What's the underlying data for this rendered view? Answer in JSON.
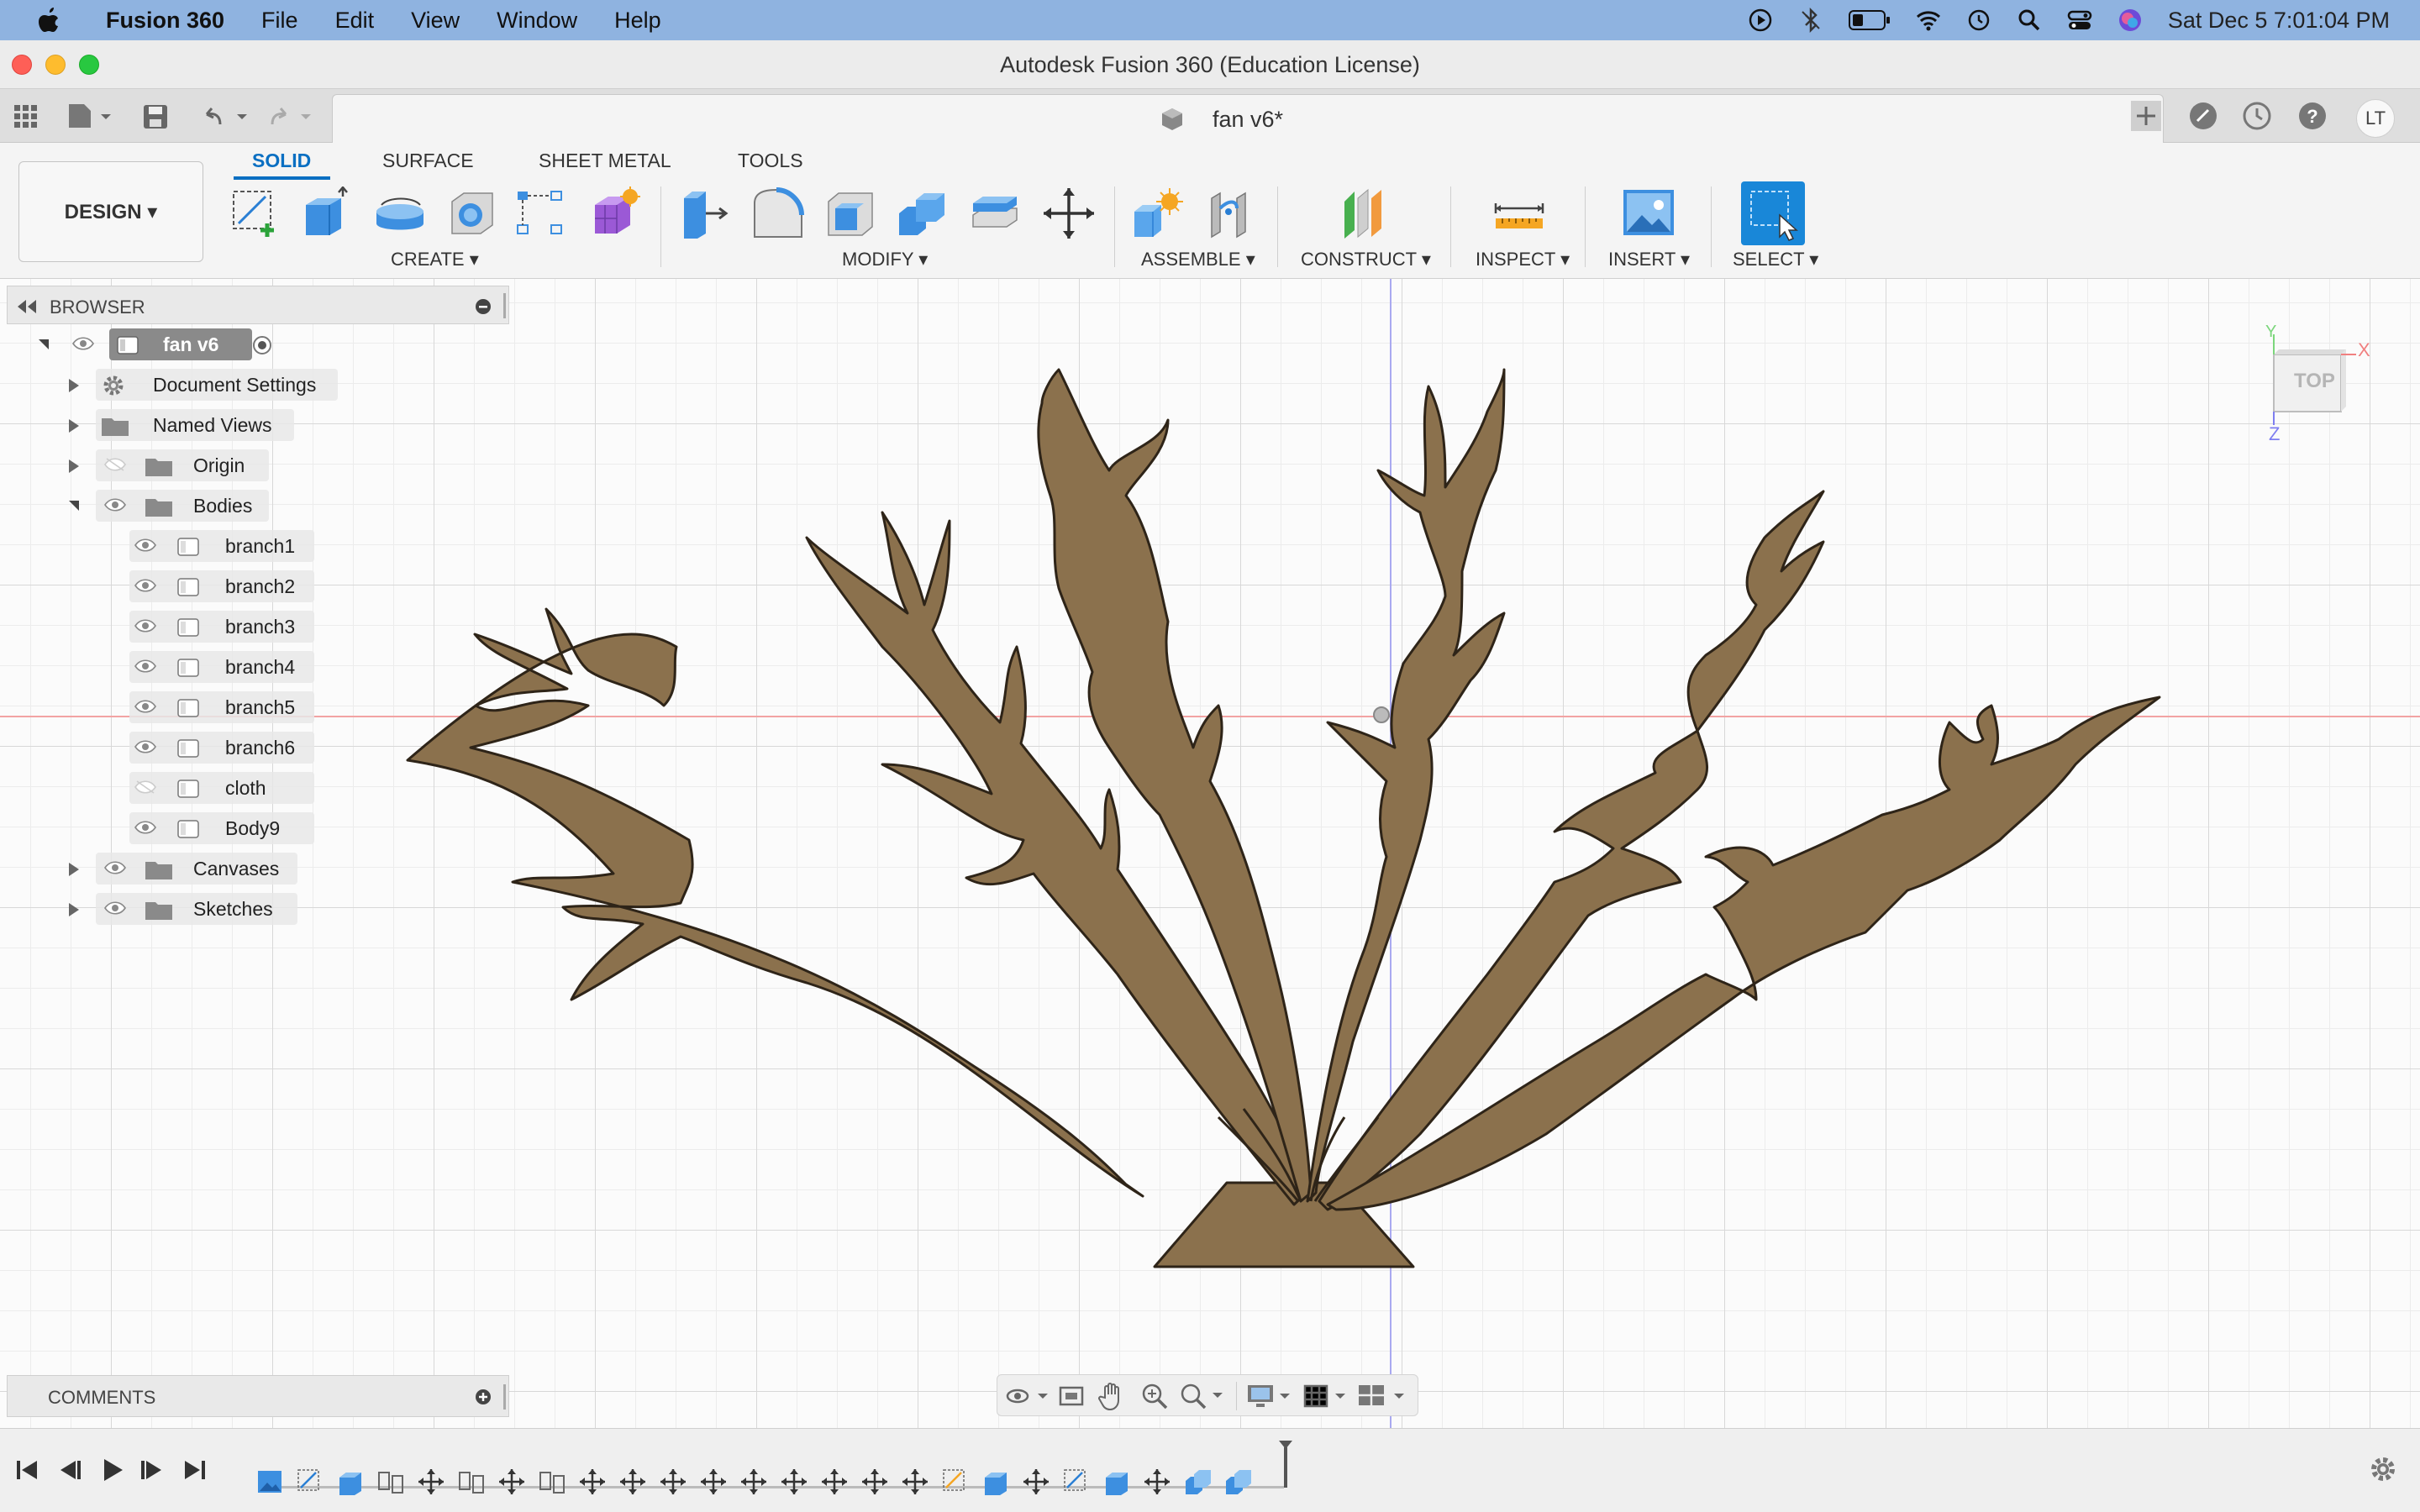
{
  "menubar": {
    "app_name": "Fusion 360",
    "items": [
      "File",
      "Edit",
      "View",
      "Window",
      "Help"
    ],
    "datetime": "Sat Dec 5  7:01:04 PM"
  },
  "window": {
    "title": "Autodesk Fusion 360 (Education License)"
  },
  "tabbar": {
    "doc_tab": "fan v6*",
    "user_initials": "LT"
  },
  "ribbon": {
    "workspace": "DESIGN",
    "tabs": [
      "SOLID",
      "SURFACE",
      "SHEET METAL",
      "TOOLS"
    ],
    "active_tab": "SOLID",
    "groups": {
      "create": "CREATE",
      "modify": "MODIFY",
      "assemble": "ASSEMBLE",
      "construct": "CONSTRUCT",
      "inspect": "INSPECT",
      "insert": "INSERT",
      "select": "SELECT"
    }
  },
  "browser": {
    "title": "BROWSER",
    "root": "fan v6",
    "nodes": {
      "doc_settings": "Document Settings",
      "named_views": "Named Views",
      "origin": "Origin",
      "bodies": "Bodies",
      "canvases": "Canvases",
      "sketches": "Sketches"
    },
    "bodies": [
      "branch1",
      "branch2",
      "branch3",
      "branch4",
      "branch5",
      "branch6",
      "cloth",
      "Body9"
    ]
  },
  "comments": {
    "title": "COMMENTS"
  },
  "viewcube": {
    "face": "TOP",
    "axis_x": "X",
    "axis_y": "Y",
    "axis_z": "Z"
  },
  "colors": {
    "model_fill": "#8b714d",
    "accent": "#0a6fc2",
    "menubar": "#8fb3e0"
  }
}
